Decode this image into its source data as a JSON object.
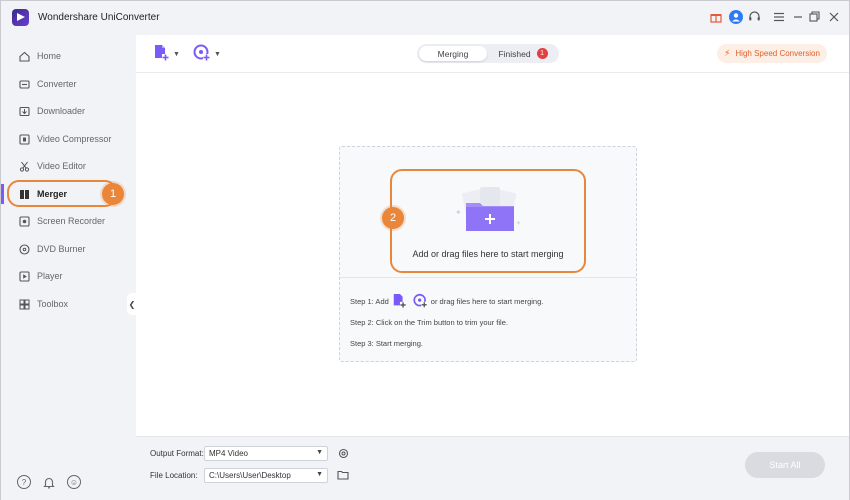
{
  "app": {
    "title": "Wondershare UniConverter",
    "accent_color": "#7a5af8",
    "callout_color": "#e9863a"
  },
  "titlebar": {
    "icons": [
      "gift-icon",
      "user-icon",
      "headset-icon",
      "menu-icon",
      "minimize-icon",
      "maximize-icon",
      "close-icon"
    ]
  },
  "sidebar": {
    "items": [
      {
        "label": "Home",
        "icon": "home-icon"
      },
      {
        "label": "Converter",
        "icon": "converter-icon"
      },
      {
        "label": "Downloader",
        "icon": "downloader-icon"
      },
      {
        "label": "Video Compressor",
        "icon": "compressor-icon"
      },
      {
        "label": "Video Editor",
        "icon": "scissors-icon"
      },
      {
        "label": "Merger",
        "icon": "merger-icon",
        "active": true
      },
      {
        "label": "Screen Recorder",
        "icon": "screen-recorder-icon"
      },
      {
        "label": "DVD Burner",
        "icon": "disc-icon"
      },
      {
        "label": "Player",
        "icon": "player-icon"
      },
      {
        "label": "Toolbox",
        "icon": "toolbox-icon"
      }
    ],
    "bottom_icons": [
      "help-icon",
      "bell-icon",
      "feedback-icon"
    ]
  },
  "callouts": {
    "one": "1",
    "two": "2"
  },
  "toolbar": {
    "add_file_icon": "add-file-icon",
    "add_media_icon": "add-media-icon"
  },
  "tabs": {
    "merging": "Merging",
    "finished": "Finished",
    "finished_badge": "1"
  },
  "high_speed": {
    "label": "High Speed Conversion"
  },
  "drop": {
    "text": "Add or drag files here to start merging",
    "step1_prefix": "Step 1: Add",
    "step1_suffix": "or drag files here to start merging.",
    "step2": "Step 2: Click on the Trim button to trim your file.",
    "step3": "Step 3: Start merging."
  },
  "footer": {
    "output_format_label": "Output Format:",
    "output_format_value": "MP4 Video",
    "file_location_label": "File Location:",
    "file_location_value": "C:\\Users\\User\\Desktop",
    "start_all": "Start All"
  }
}
